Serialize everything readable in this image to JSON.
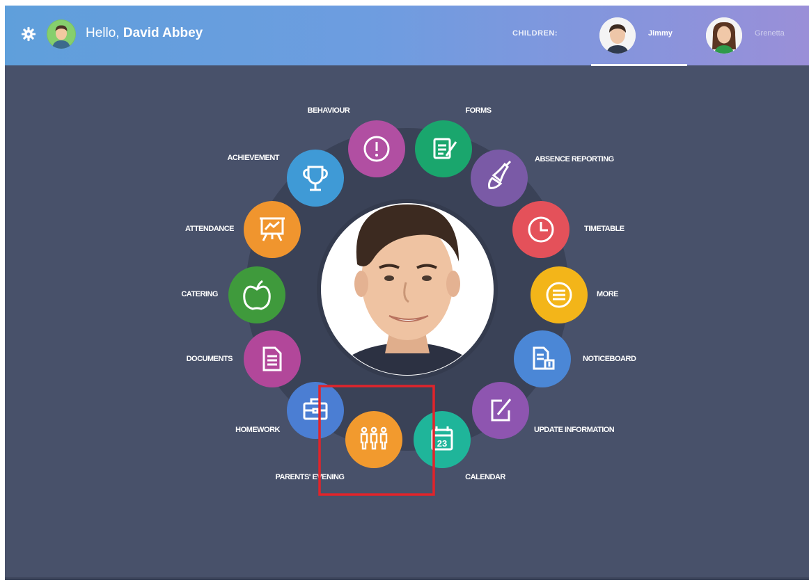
{
  "header": {
    "greeting_prefix": "Hello,",
    "user_name": "David Abbey",
    "children_label": "CHILDREN:",
    "children": [
      {
        "name": "Jimmy",
        "selected": true
      },
      {
        "name": "Grenetta",
        "selected": false
      }
    ]
  },
  "menu": {
    "items": [
      {
        "label": "BEHAVIOUR",
        "color": "#b14fa2",
        "icon": "exclamation-icon"
      },
      {
        "label": "FORMS",
        "color": "#1aa66d",
        "icon": "form-icon"
      },
      {
        "label": "ABSENCE REPORTING",
        "color": "#7a5aa6",
        "icon": "bell-icon"
      },
      {
        "label": "TIMETABLE",
        "color": "#e4515a",
        "icon": "clock-icon"
      },
      {
        "label": "MORE",
        "color": "#f3b519",
        "icon": "menu-lines-icon"
      },
      {
        "label": "NOTICEBOARD",
        "color": "#4b87d6",
        "icon": "noticeboard-icon"
      },
      {
        "label": "UPDATE INFORMATION",
        "color": "#8e55b0",
        "icon": "edit-icon"
      },
      {
        "label": "CALENDAR",
        "color": "#1fb59a",
        "icon": "calendar-icon",
        "day": "23"
      },
      {
        "label": "PARENTS' EVENING",
        "color": "#f29a2e",
        "icon": "people-icon"
      },
      {
        "label": "HOMEWORK",
        "color": "#4b7ed3",
        "icon": "briefcase-icon"
      },
      {
        "label": "DOCUMENTS",
        "color": "#b2479a",
        "icon": "document-icon"
      },
      {
        "label": "CATERING",
        "color": "#3f9a3c",
        "icon": "apple-icon"
      },
      {
        "label": "ATTENDANCE",
        "color": "#f0952e",
        "icon": "presentation-icon"
      },
      {
        "label": "ACHIEVEMENT",
        "color": "#3f9ad6",
        "icon": "trophy-icon"
      }
    ]
  },
  "highlight": {
    "target": "PARENTS' EVENING",
    "color": "#e0242b"
  },
  "colors": {
    "background": "#48516a",
    "ring": "#3a4257"
  }
}
